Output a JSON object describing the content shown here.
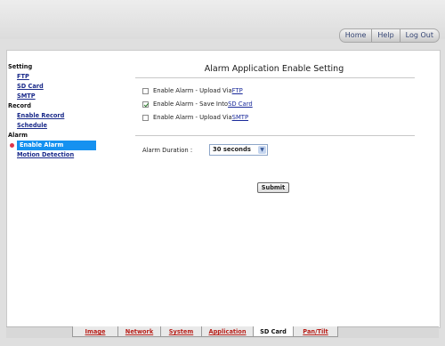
{
  "topnav": {
    "home": "Home",
    "help": "Help",
    "logout": "Log Out"
  },
  "sidebar": {
    "setting_head": "Setting",
    "ftp": "FTP",
    "sd_card": "SD Card",
    "smtp": "SMTP",
    "record_head": "Record",
    "enable_record": "Enable Record",
    "schedule": "Schedule",
    "alarm_head": "Alarm",
    "enable_alarm": "Enable Alarm",
    "motion_detection": "Motion Detection"
  },
  "main": {
    "title": "Alarm Application Enable Setting",
    "options": [
      {
        "prefix": "Enable Alarm - Upload Via ",
        "link": "FTP",
        "checked": false
      },
      {
        "prefix": "Enable Alarm - Save Into ",
        "link": "SD Card",
        "checked": true
      },
      {
        "prefix": "Enable Alarm - Upload Via ",
        "link": "SMTP",
        "checked": false
      }
    ],
    "duration_label": "Alarm Duration :",
    "duration_value": "30 seconds",
    "submit": "Submit"
  },
  "tabs": [
    "Image",
    "Network",
    "System",
    "Application",
    "SD Card",
    "Pan/Tilt"
  ],
  "selected_tab": "SD Card",
  "colors": {
    "accent": "#1591f0",
    "tab_link": "#b8201a",
    "link": "#1a2a8a"
  }
}
